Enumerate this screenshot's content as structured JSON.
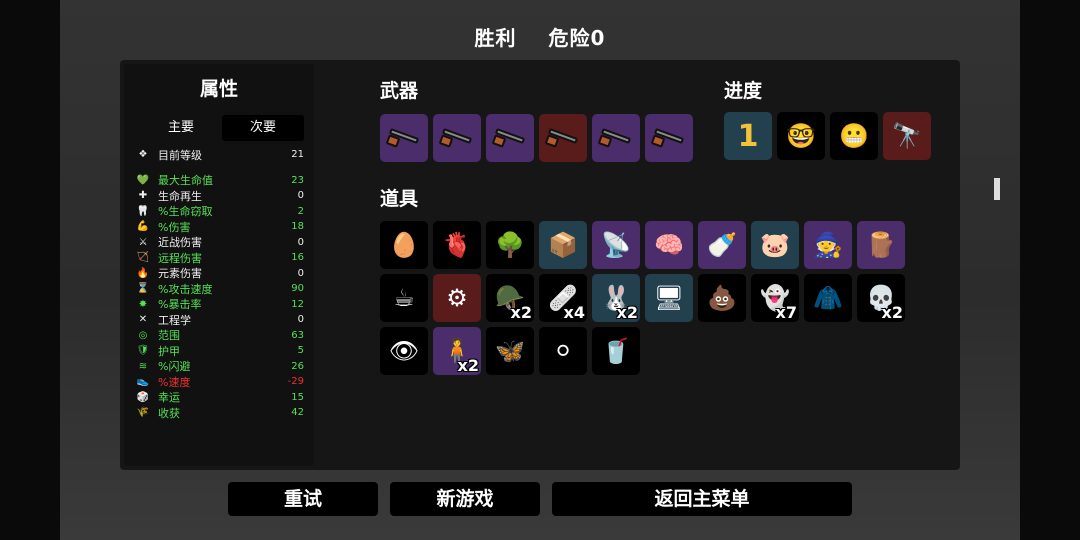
{
  "header": {
    "result": "胜利",
    "danger": "危险0"
  },
  "stats": {
    "title": "属性",
    "tabs": [
      {
        "label": "主要",
        "active": false
      },
      {
        "label": "次要",
        "active": true
      }
    ],
    "level": {
      "name": "目前等级",
      "value": "21"
    },
    "rows": [
      {
        "name": "最大生命值",
        "value": "23",
        "color": "g",
        "icon": "💚"
      },
      {
        "name": "生命再生",
        "value": "0",
        "color": "w",
        "icon": "✚"
      },
      {
        "name": "%生命窃取",
        "value": "2",
        "color": "g",
        "icon": "🦷"
      },
      {
        "name": "%伤害",
        "value": "18",
        "color": "g",
        "icon": "💪"
      },
      {
        "name": "近战伤害",
        "value": "0",
        "color": "w",
        "icon": "⚔"
      },
      {
        "name": "远程伤害",
        "value": "16",
        "color": "g",
        "icon": "🏹"
      },
      {
        "name": "元素伤害",
        "value": "0",
        "color": "w",
        "icon": "🔥"
      },
      {
        "name": "%攻击速度",
        "value": "90",
        "color": "g",
        "icon": "⌛"
      },
      {
        "name": "%暴击率",
        "value": "12",
        "color": "g",
        "icon": "✸"
      },
      {
        "name": "工程学",
        "value": "0",
        "color": "w",
        "icon": "✕"
      },
      {
        "name": "范围",
        "value": "63",
        "color": "g",
        "icon": "◎"
      },
      {
        "name": "护甲",
        "value": "5",
        "color": "g",
        "icon": "🛡"
      },
      {
        "name": "%闪避",
        "value": "26",
        "color": "g",
        "icon": "≋"
      },
      {
        "name": "%速度",
        "value": "-29",
        "color": "r",
        "icon": "👟"
      },
      {
        "name": "幸运",
        "value": "15",
        "color": "g",
        "icon": "🎲"
      },
      {
        "name": "收获",
        "value": "42",
        "color": "g",
        "icon": "🌾"
      }
    ]
  },
  "weapons": {
    "title": "武器",
    "items": [
      {
        "tier": "purple",
        "icon": "gun-icon"
      },
      {
        "tier": "purple",
        "icon": "gun-icon"
      },
      {
        "tier": "purple",
        "icon": "gun-icon"
      },
      {
        "tier": "red",
        "icon": "gun-icon"
      },
      {
        "tier": "purple",
        "icon": "gun-icon"
      },
      {
        "tier": "purple",
        "icon": "gun-icon"
      }
    ]
  },
  "progress": {
    "title": "进度",
    "items": [
      {
        "tier": "blue",
        "glyph": "1",
        "icon": "number-one-icon"
      },
      {
        "tier": "black",
        "glyph": "🤓",
        "icon": "nerd-egg-icon"
      },
      {
        "tier": "black",
        "glyph": "😬",
        "icon": "egg-face-icon"
      },
      {
        "tier": "red",
        "glyph": "🔭",
        "icon": "binoculars-icon"
      }
    ]
  },
  "items": {
    "title": "道具",
    "rows": [
      [
        {
          "tier": "black",
          "glyph": "🥚",
          "icon": "egg-icon",
          "qty": ""
        },
        {
          "tier": "black",
          "glyph": "🫀",
          "icon": "organ-icon",
          "qty": ""
        },
        {
          "tier": "black",
          "glyph": "🌳",
          "icon": "tree-icon",
          "qty": ""
        },
        {
          "tier": "blue",
          "glyph": "📦",
          "icon": "crate-icon",
          "qty": ""
        },
        {
          "tier": "purple",
          "glyph": "📡",
          "icon": "drone-icon",
          "qty": ""
        },
        {
          "tier": "purple",
          "glyph": "🧠",
          "icon": "brain-icon",
          "qty": ""
        },
        {
          "tier": "purple",
          "glyph": "🍼",
          "icon": "bottle-icon",
          "qty": ""
        },
        {
          "tier": "blue",
          "glyph": "🐷",
          "icon": "pig-icon",
          "qty": ""
        },
        {
          "tier": "purple",
          "glyph": "🧙",
          "icon": "hooded-figure-icon",
          "qty": ""
        },
        {
          "tier": "purple",
          "glyph": "🪵",
          "icon": "plank-icon",
          "qty": ""
        }
      ],
      [
        {
          "tier": "black",
          "glyph": "☕",
          "icon": "coffee-icon",
          "qty": ""
        },
        {
          "tier": "red",
          "glyph": "⚙",
          "icon": "gear-orb-icon",
          "qty": ""
        },
        {
          "tier": "black",
          "glyph": "🪖",
          "icon": "helmet-icon",
          "qty": "x2"
        },
        {
          "tier": "black",
          "glyph": "🩹",
          "icon": "bandage-icon",
          "qty": "x4"
        },
        {
          "tier": "blue",
          "glyph": "🐰",
          "icon": "rabbit-icon",
          "qty": "x2"
        },
        {
          "tier": "blue",
          "glyph": "🖥",
          "icon": "terminal-icon",
          "qty": ""
        },
        {
          "tier": "black",
          "glyph": "💩",
          "icon": "poop-icon",
          "qty": ""
        },
        {
          "tier": "black",
          "glyph": "👻",
          "icon": "ghost-icon",
          "qty": "x7"
        },
        {
          "tier": "black",
          "glyph": "🧥",
          "icon": "jacket-icon",
          "qty": ""
        },
        {
          "tier": "black",
          "glyph": "💀",
          "icon": "skull-icon",
          "qty": "x2"
        }
      ],
      [
        {
          "tier": "black",
          "glyph": "👁",
          "icon": "eye-creature-icon",
          "qty": ""
        },
        {
          "tier": "purple",
          "glyph": "🧍",
          "icon": "alien-figure-icon",
          "qty": "x2"
        },
        {
          "tier": "black",
          "glyph": "🦋",
          "icon": "butterfly-icon",
          "qty": ""
        },
        {
          "tier": "black",
          "glyph": "⚪",
          "icon": "slime-icon",
          "qty": ""
        },
        {
          "tier": "black",
          "glyph": "🥤",
          "icon": "cup-icon",
          "qty": ""
        }
      ]
    ]
  },
  "buttons": {
    "retry": "重试",
    "new_game": "新游戏",
    "main_menu": "返回主菜单"
  }
}
